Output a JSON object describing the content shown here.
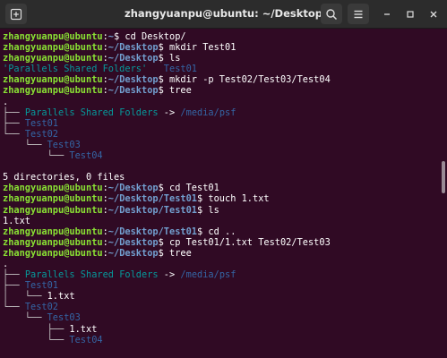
{
  "window": {
    "title": "zhangyuanpu@ubuntu: ~/Desktop",
    "buttons": {
      "new_tab": "new-tab-icon",
      "search": "search-icon",
      "menu": "hamburger-menu-icon",
      "minimize": "minimize-icon",
      "maximize": "maximize-icon",
      "close": "close-icon"
    }
  },
  "terminal": {
    "user_host": "zhangyuanpu@ubuntu",
    "lines": [
      {
        "kind": "prompt",
        "path": "~",
        "command": "cd Desktop/"
      },
      {
        "kind": "prompt",
        "path": "~/Desktop",
        "command": "mkdir Test01"
      },
      {
        "kind": "prompt",
        "path": "~/Desktop",
        "command": "ls"
      },
      {
        "kind": "ls",
        "quoted": "'Parallels Shared Folders'",
        "dir": "Test01"
      },
      {
        "kind": "prompt",
        "path": "~/Desktop",
        "command": "mkdir -p Test02/Test03/Test04"
      },
      {
        "kind": "prompt",
        "path": "~/Desktop",
        "command": "tree"
      },
      {
        "kind": "tree",
        "prefix": "",
        "name": ".",
        "style": "plain"
      },
      {
        "kind": "tree",
        "prefix": "├── ",
        "name": "Parallels Shared Folders",
        "arrow": " -> ",
        "target": "/media/psf",
        "style": "link"
      },
      {
        "kind": "tree",
        "prefix": "├── ",
        "name": "Test01",
        "style": "dir"
      },
      {
        "kind": "tree",
        "prefix": "└── ",
        "name": "Test02",
        "style": "dir"
      },
      {
        "kind": "tree",
        "prefix": "    └── ",
        "name": "Test03",
        "style": "dir"
      },
      {
        "kind": "tree",
        "prefix": "        └── ",
        "name": "Test04",
        "style": "dir"
      },
      {
        "kind": "blank"
      },
      {
        "kind": "text",
        "text": "5 directories, 0 files"
      },
      {
        "kind": "prompt",
        "path": "~/Desktop",
        "command": "cd Test01"
      },
      {
        "kind": "prompt",
        "path": "~/Desktop/Test01",
        "command": "touch 1.txt"
      },
      {
        "kind": "prompt",
        "path": "~/Desktop/Test01",
        "command": "ls"
      },
      {
        "kind": "text",
        "text": "1.txt"
      },
      {
        "kind": "prompt",
        "path": "~/Desktop/Test01",
        "command": "cd .."
      },
      {
        "kind": "prompt",
        "path": "~/Desktop",
        "command": "cp Test01/1.txt Test02/Test03"
      },
      {
        "kind": "prompt",
        "path": "~/Desktop",
        "command": "tree"
      },
      {
        "kind": "tree",
        "prefix": "",
        "name": ".",
        "style": "plain"
      },
      {
        "kind": "tree",
        "prefix": "├── ",
        "name": "Parallels Shared Folders",
        "arrow": " -> ",
        "target": "/media/psf",
        "style": "link"
      },
      {
        "kind": "tree",
        "prefix": "├── ",
        "name": "Test01",
        "style": "dir"
      },
      {
        "kind": "tree",
        "prefix": "│   └── ",
        "name": "1.txt",
        "style": "plain"
      },
      {
        "kind": "tree",
        "prefix": "└── ",
        "name": "Test02",
        "style": "dir"
      },
      {
        "kind": "tree",
        "prefix": "    └── ",
        "name": "Test03",
        "style": "dir"
      },
      {
        "kind": "tree",
        "prefix": "        ├── ",
        "name": "1.txt",
        "style": "plain"
      },
      {
        "kind": "tree",
        "prefix": "        └── ",
        "name": "Test04",
        "style": "dir"
      }
    ]
  },
  "colors": {
    "background": "#300a24",
    "titlebar": "#2c2c2c",
    "user_host": "#8ae234",
    "path": "#729fcf",
    "directory": "#3465a4",
    "symlink": "#06989a",
    "text": "#ffffff"
  }
}
